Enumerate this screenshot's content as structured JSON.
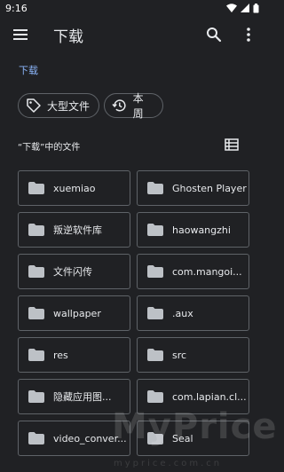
{
  "status": {
    "time": "9:16",
    "icons": [
      "wifi-icon",
      "cell-signal-icon",
      "battery-icon"
    ]
  },
  "app_bar": {
    "title": "下载",
    "menu_icon": "hamburger-menu-icon",
    "search_icon": "search-icon",
    "more_icon": "more-vert-icon"
  },
  "breadcrumb": "下载",
  "chips": [
    {
      "label": "大型文件",
      "icon": "tag-icon"
    },
    {
      "label": "本周",
      "icon": "history-icon"
    }
  ],
  "section": {
    "title": "“下载”中的文件",
    "view_icon": "list-view-icon"
  },
  "folders": [
    {
      "label": "xuemiao"
    },
    {
      "label": "Ghosten Player"
    },
    {
      "label": "叛逆软件库"
    },
    {
      "label": "haowangzhi"
    },
    {
      "label": "文件闪传"
    },
    {
      "label": "com.mangoi..."
    },
    {
      "label": "wallpaper"
    },
    {
      "label": ".aux"
    },
    {
      "label": "res"
    },
    {
      "label": "src"
    },
    {
      "label": "隐藏应用图..."
    },
    {
      "label": "com.lapian.cl..."
    },
    {
      "label": "video_conver..."
    },
    {
      "label": "Seal"
    }
  ],
  "watermark": {
    "text": "MyPrice",
    "sub": "myprice.com.cn"
  },
  "colors": {
    "background": "#202124",
    "accent": "#8ab4f8",
    "border": "#5f6368",
    "folder": "#bdc1c6"
  }
}
